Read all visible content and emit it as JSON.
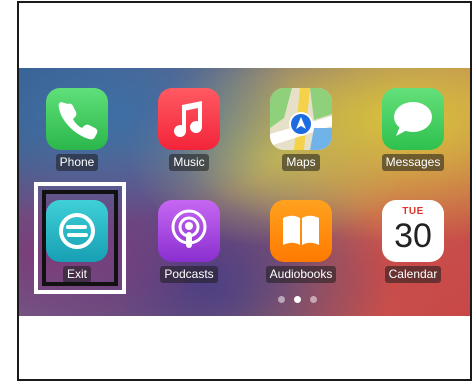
{
  "apps": [
    {
      "label": "Phone",
      "icon": "phone-icon"
    },
    {
      "label": "Music",
      "icon": "music-note-icon"
    },
    {
      "label": "Maps",
      "icon": "maps-icon"
    },
    {
      "label": "Messages",
      "icon": "messages-bubble-icon"
    },
    {
      "label": "Exit",
      "icon": "exit-icon"
    },
    {
      "label": "Podcasts",
      "icon": "podcasts-icon"
    },
    {
      "label": "Audiobooks",
      "icon": "book-icon"
    },
    {
      "label": "Calendar",
      "icon": "calendar-icon"
    }
  ],
  "calendar": {
    "weekday": "TUE",
    "day": "30"
  },
  "page_indicator": {
    "pages": 3,
    "current": 2
  },
  "colors": {
    "phone": "#34c759",
    "music": "#fc3c44",
    "messages": "#34c759",
    "exit": "#21b5c4",
    "podcasts": "#9b3fd8",
    "audiobooks": "#ff8a00",
    "calendar_accent": "#e0342b",
    "highlight_outer": "#ffffff",
    "highlight_inner": "#111111"
  }
}
